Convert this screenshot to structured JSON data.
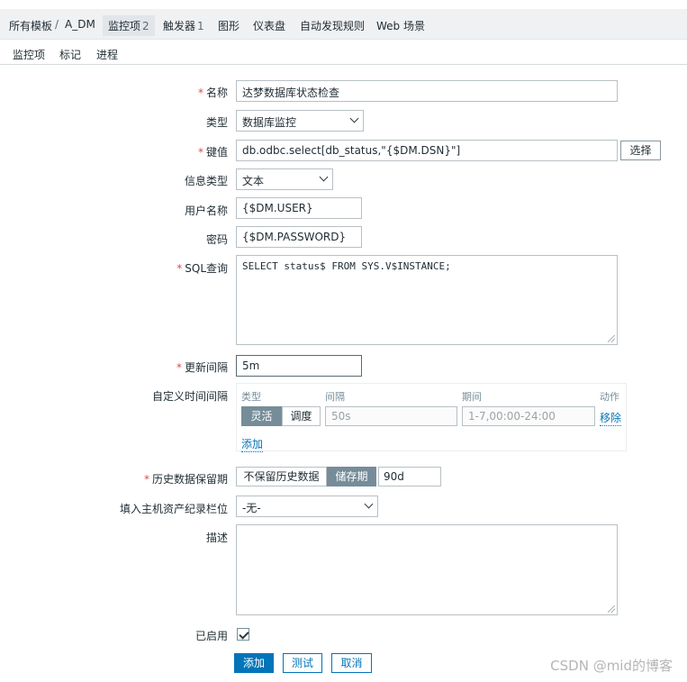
{
  "breadcrumb": {
    "all_templates": "所有模板",
    "separator": "/",
    "template": "A_DM",
    "items_tab": "监控项",
    "items_count": "2",
    "triggers": "触发器",
    "triggers_count": "1",
    "graphs": "图形",
    "dashboards": "仪表盘",
    "discovery": "自动发现规则",
    "web": "Web 场景"
  },
  "tabs": [
    "监控项",
    "标记",
    "进程"
  ],
  "form": {
    "name_label": "名称",
    "name_value": "达梦数据库状态检查",
    "type_label": "类型",
    "type_value": "数据库监控",
    "key_label": "键值",
    "key_value": "db.odbc.select[db_status,\"{$DM.DSN}\"]",
    "select_button": "选择",
    "info_type_label": "信息类型",
    "info_type_value": "文本",
    "username_label": "用户名称",
    "username_value": "{$DM.USER}",
    "password_label": "密码",
    "password_value": "{$DM.PASSWORD}",
    "sql_label": "SQL查询",
    "sql_value": "SELECT status$ FROM SYS.V$INSTANCE;",
    "interval_label": "更新间隔",
    "interval_value": "5m",
    "custom_label": "自定义时间间隔",
    "custom": {
      "col_type": "类型",
      "col_interval": "间隔",
      "col_period": "期间",
      "col_action": "动作",
      "seg_flexible": "灵活",
      "seg_scheduling": "调度",
      "interval_placeholder": "50s",
      "period_placeholder": "1-7,00:00-24:00",
      "remove_link": "移除",
      "add_link": "添加"
    },
    "history_label": "历史数据保留期",
    "history_no": "不保留历史数据",
    "history_store": "储存期",
    "history_value": "90d",
    "inventory_label": "填入主机资产纪录栏位",
    "inventory_value": "-无-",
    "desc_label": "描述",
    "desc_value": "",
    "enabled_label": "已启用",
    "enabled": true
  },
  "actions": {
    "add": "添加",
    "test": "测试",
    "cancel": "取消"
  },
  "watermark": "CSDN @mid的博客",
  "colors": {
    "accent": "#0275b8",
    "segment_on": "#768d99",
    "required": "#d64e4e"
  }
}
